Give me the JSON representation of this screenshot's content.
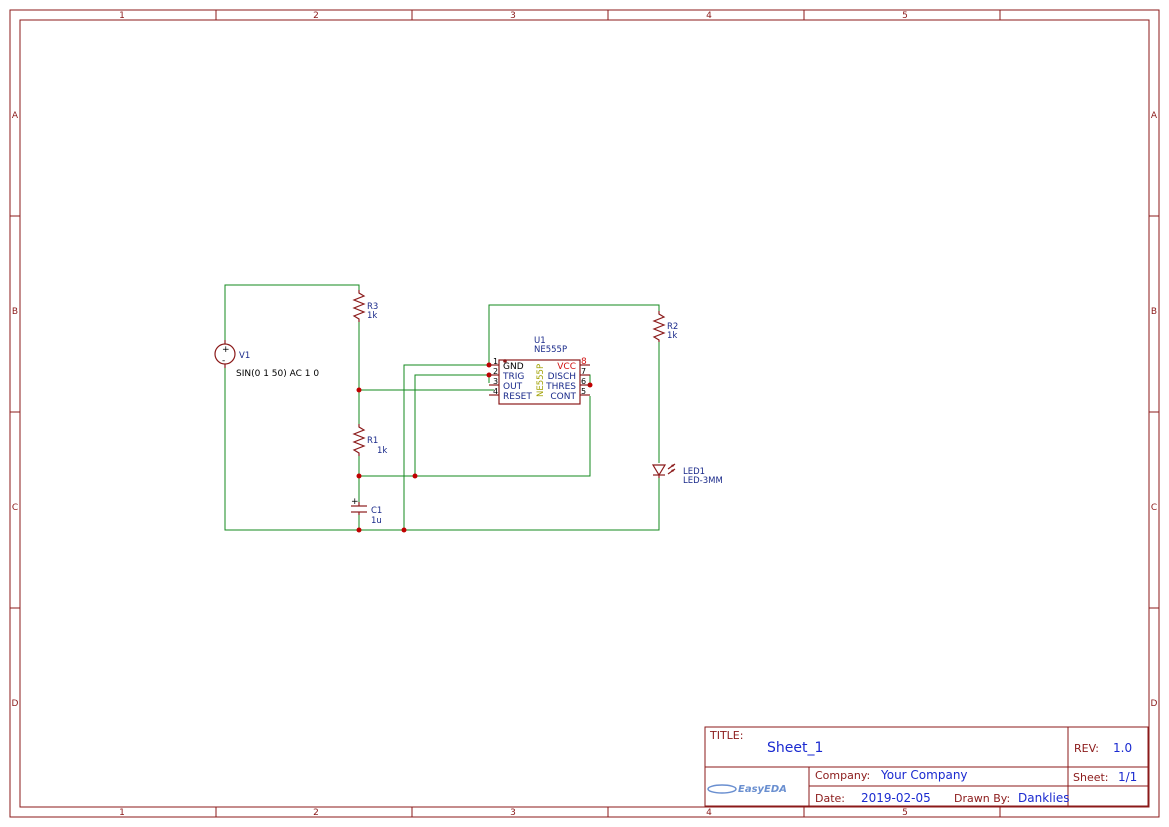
{
  "frame": {
    "columns": [
      "1",
      "2",
      "3",
      "4",
      "5"
    ],
    "rows": [
      "A",
      "B",
      "C",
      "D"
    ]
  },
  "components": {
    "v1": {
      "ref": "V1",
      "value": "SIN(0 1 50) AC 1 0",
      "plus": "+",
      "minus": "-"
    },
    "r3": {
      "ref": "R3",
      "value": "1k"
    },
    "r1": {
      "ref": "R1",
      "value": "1k"
    },
    "r2": {
      "ref": "R2",
      "value": "1k"
    },
    "c1": {
      "ref": "C1",
      "value": "1u",
      "plus": "+"
    },
    "led1": {
      "ref": "LED1",
      "value": "LED-3MM"
    },
    "u1": {
      "ref": "U1",
      "value": "NE555P",
      "body_label": "NE555P",
      "pins_left": [
        {
          "num": "1",
          "name": "GND"
        },
        {
          "num": "2",
          "name": "TRIG"
        },
        {
          "num": "3",
          "name": "OUT"
        },
        {
          "num": "4",
          "name": "RESET"
        }
      ],
      "pins_right": [
        {
          "num": "8",
          "name": "VCC"
        },
        {
          "num": "7",
          "name": "DISCH"
        },
        {
          "num": "6",
          "name": "THRES"
        },
        {
          "num": "5",
          "name": "CONT"
        }
      ]
    }
  },
  "title_block": {
    "title_label": "TITLE:",
    "title": "Sheet_1",
    "rev_label": "REV:",
    "rev": "1.0",
    "company_label": "Company:",
    "company": "Your Company",
    "sheet_label": "Sheet:",
    "sheet": "1/1",
    "date_label": "Date:",
    "date": "2019-02-05",
    "drawn_label": "Drawn By:",
    "drawn_by": "Danklies",
    "logo": "EasyEDA"
  },
  "colors": {
    "frame": "#8b1a1a",
    "wire": "#138a1e",
    "junction": "#c00000",
    "label": "#1a2a8a",
    "title_value": "#1a2ad0"
  }
}
